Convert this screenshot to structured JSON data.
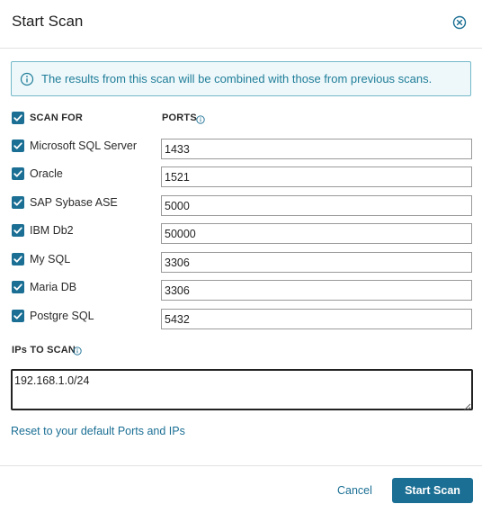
{
  "dialog": {
    "title": "Start Scan",
    "close_icon": "close-circle-icon"
  },
  "info_banner": {
    "icon": "info-icon",
    "text": "The results from this scan will be combined with those from previous scans."
  },
  "scan_for": {
    "header_label": "SCAN FOR",
    "header_checked": true,
    "ports_header_label": "PORTS",
    "items": [
      {
        "label": "Microsoft SQL Server",
        "checked": true,
        "port": "1433"
      },
      {
        "label": "Oracle",
        "checked": true,
        "port": "1521"
      },
      {
        "label": "SAP Sybase ASE",
        "checked": true,
        "port": "5000"
      },
      {
        "label": "IBM Db2",
        "checked": true,
        "port": "50000"
      },
      {
        "label": "My SQL",
        "checked": true,
        "port": "3306"
      },
      {
        "label": "Maria DB",
        "checked": true,
        "port": "3306"
      },
      {
        "label": "Postgre SQL",
        "checked": true,
        "port": "5432"
      }
    ]
  },
  "ips": {
    "label": "IPs TO SCAN",
    "value": "192.168.1.0/24"
  },
  "reset_link": "Reset to your default Ports and IPs",
  "footer": {
    "cancel_label": "Cancel",
    "start_label": "Start Scan"
  },
  "colors": {
    "accent": "#1b6f94",
    "banner_bg": "#eef8fb",
    "banner_border": "#74b9c9",
    "banner_text": "#1f7d98"
  }
}
